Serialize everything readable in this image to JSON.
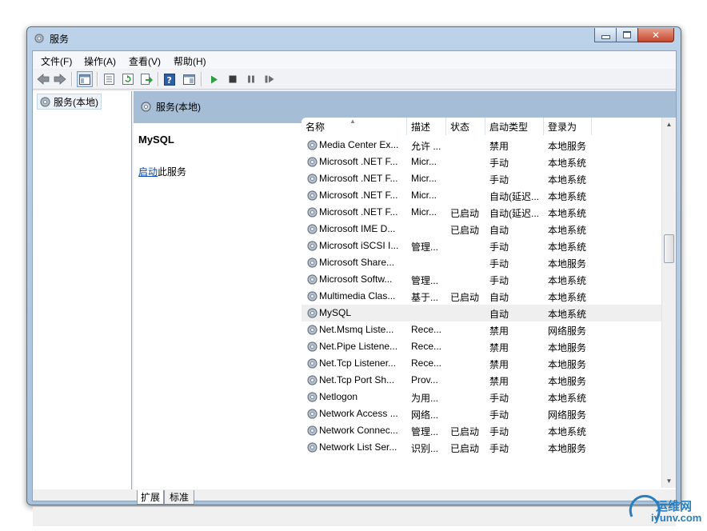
{
  "window": {
    "title": "服务",
    "icon": "gear-icon"
  },
  "menu": [
    {
      "label": "文件(F)"
    },
    {
      "label": "操作(A)"
    },
    {
      "label": "查看(V)"
    },
    {
      "label": "帮助(H)"
    }
  ],
  "toolbar_icons": [
    "back-arrow-icon",
    "forward-arrow-icon",
    "show-tree-icon",
    "properties-icon",
    "refresh-icon",
    "export-icon",
    "help-icon",
    "console-icon",
    "start-icon",
    "stop-icon",
    "pause-icon",
    "resume-icon"
  ],
  "tree": {
    "root_label": "服务(本地)"
  },
  "header": {
    "title": "服务(本地)"
  },
  "detail": {
    "service_name": "MySQL",
    "action_link": "启动",
    "action_suffix": "此服务"
  },
  "columns": [
    {
      "label": "名称"
    },
    {
      "label": "描述"
    },
    {
      "label": "状态"
    },
    {
      "label": "启动类型"
    },
    {
      "label": "登录为"
    }
  ],
  "rows": [
    {
      "name": "Media Center Ex...",
      "desc": "允许 ...",
      "status": "",
      "startup": "禁用",
      "logon": "本地服务"
    },
    {
      "name": "Microsoft .NET F...",
      "desc": "Micr...",
      "status": "",
      "startup": "手动",
      "logon": "本地系统"
    },
    {
      "name": "Microsoft .NET F...",
      "desc": "Micr...",
      "status": "",
      "startup": "手动",
      "logon": "本地系统"
    },
    {
      "name": "Microsoft .NET F...",
      "desc": "Micr...",
      "status": "",
      "startup": "自动(延迟...",
      "logon": "本地系统"
    },
    {
      "name": "Microsoft .NET F...",
      "desc": "Micr...",
      "status": "已启动",
      "startup": "自动(延迟...",
      "logon": "本地系统"
    },
    {
      "name": "Microsoft IME D...",
      "desc": "",
      "status": "已启动",
      "startup": "自动",
      "logon": "本地系统"
    },
    {
      "name": "Microsoft iSCSI I...",
      "desc": "管理...",
      "status": "",
      "startup": "手动",
      "logon": "本地系统"
    },
    {
      "name": "Microsoft Share...",
      "desc": "",
      "status": "",
      "startup": "手动",
      "logon": "本地服务"
    },
    {
      "name": "Microsoft Softw...",
      "desc": "管理...",
      "status": "",
      "startup": "手动",
      "logon": "本地系统"
    },
    {
      "name": "Multimedia Clas...",
      "desc": "基于...",
      "status": "已启动",
      "startup": "自动",
      "logon": "本地系统"
    },
    {
      "name": "MySQL",
      "desc": "",
      "status": "",
      "startup": "自动",
      "logon": "本地系统",
      "selected": true
    },
    {
      "name": "Net.Msmq Liste...",
      "desc": "Rece...",
      "status": "",
      "startup": "禁用",
      "logon": "网络服务"
    },
    {
      "name": "Net.Pipe Listene...",
      "desc": "Rece...",
      "status": "",
      "startup": "禁用",
      "logon": "本地服务"
    },
    {
      "name": "Net.Tcp Listener...",
      "desc": "Rece...",
      "status": "",
      "startup": "禁用",
      "logon": "本地服务"
    },
    {
      "name": "Net.Tcp Port Sh...",
      "desc": "Prov...",
      "status": "",
      "startup": "禁用",
      "logon": "本地服务"
    },
    {
      "name": "Netlogon",
      "desc": "为用...",
      "status": "",
      "startup": "手动",
      "logon": "本地系统"
    },
    {
      "name": "Network Access ...",
      "desc": "网络...",
      "status": "",
      "startup": "手动",
      "logon": "网络服务"
    },
    {
      "name": "Network Connec...",
      "desc": "管理...",
      "status": "已启动",
      "startup": "手动",
      "logon": "本地系统"
    },
    {
      "name": "Network List Ser...",
      "desc": "识别...",
      "status": "已启动",
      "startup": "手动",
      "logon": "本地服务"
    }
  ],
  "tabs": [
    {
      "label": "扩展",
      "active": true
    },
    {
      "label": "标准",
      "active": false
    }
  ],
  "watermark": {
    "line1": "运维网",
    "line2": "iyunv.com"
  },
  "colors": {
    "header_band": "#a6bdd6",
    "link": "#0645ad",
    "start_green": "#2e9e3e"
  }
}
